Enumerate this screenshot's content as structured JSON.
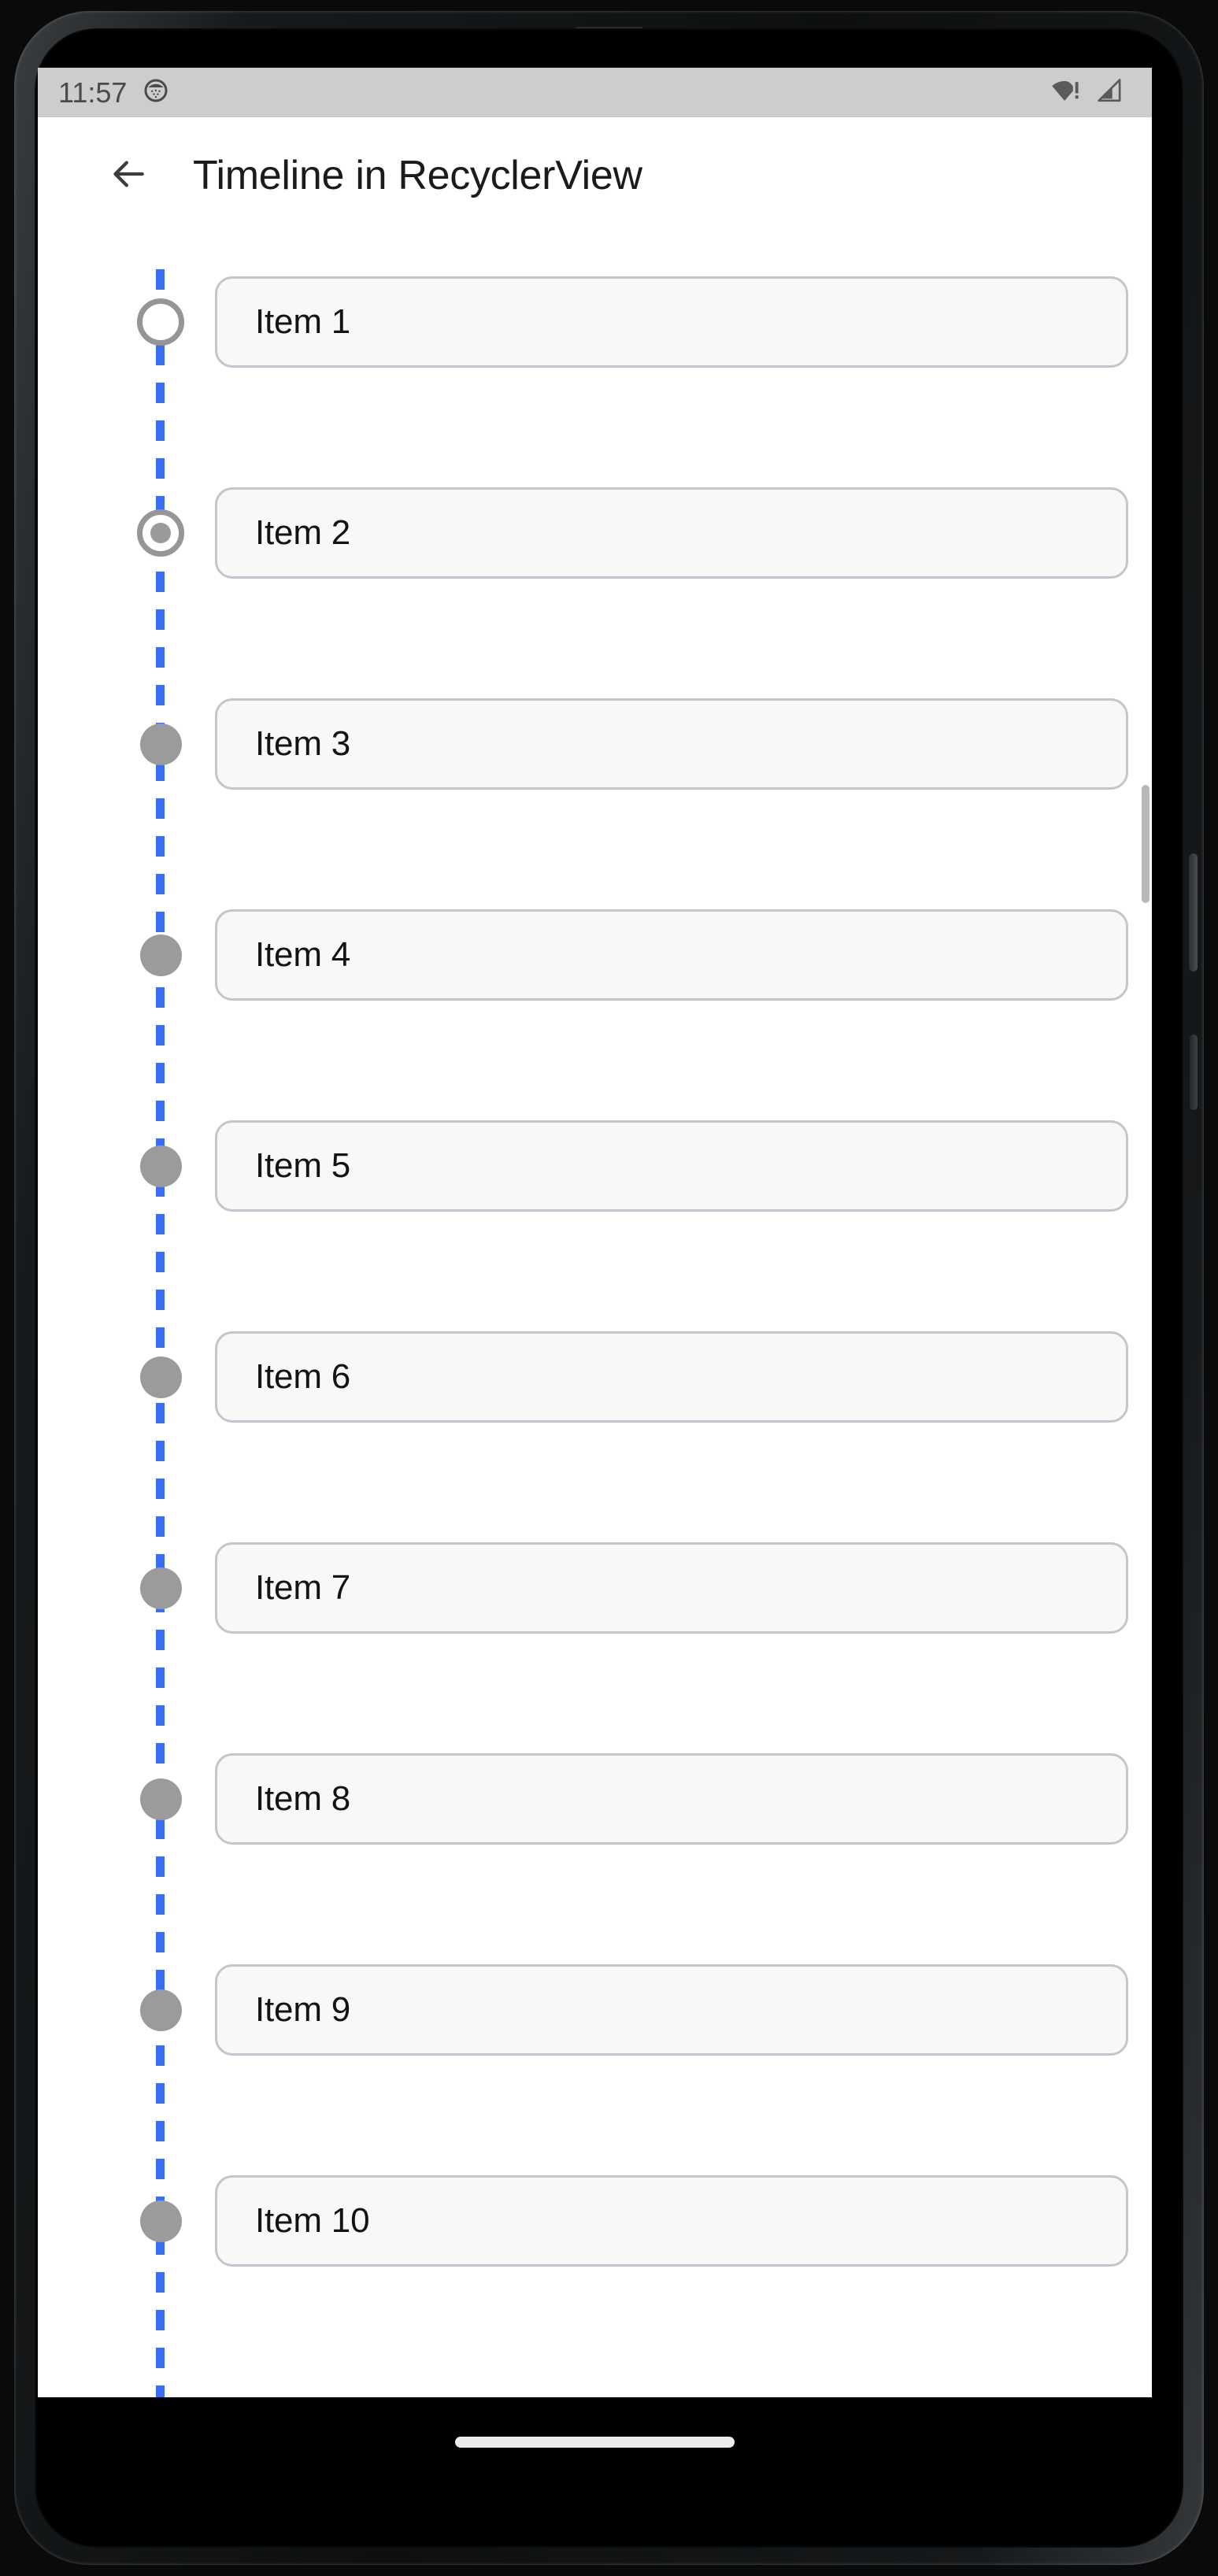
{
  "device": {
    "status_bar": {
      "time": "11:57",
      "notification_icon": "notification-dot-icon",
      "wifi_icon": "wifi-no-internet-icon",
      "signal_icon": "cellular-signal-icon",
      "background_color": "#cdcdcd",
      "icon_color": "#4a4a4a"
    },
    "nav_bar": {
      "gesture_pill": "home-gesture-pill",
      "background_color": "#000000"
    }
  },
  "app_bar": {
    "back_icon": "arrow-left-icon",
    "title": "Timeline in RecyclerView",
    "background_color": "#ffffff",
    "title_color": "#1b1b1f"
  },
  "timeline": {
    "line_color": "#3b6ef5",
    "line_style": "dashed",
    "marker_color": "#9b9b9b",
    "card_background": "#f8f8f9",
    "card_border_color": "#c9c3cd",
    "items": [
      {
        "label": "Item 1",
        "marker": "ring"
      },
      {
        "label": "Item 2",
        "marker": "ring-dot"
      },
      {
        "label": "Item 3",
        "marker": "filled"
      },
      {
        "label": "Item 4",
        "marker": "filled"
      },
      {
        "label": "Item 5",
        "marker": "filled"
      },
      {
        "label": "Item 6",
        "marker": "filled"
      },
      {
        "label": "Item 7",
        "marker": "filled"
      },
      {
        "label": "Item 8",
        "marker": "filled"
      },
      {
        "label": "Item 9",
        "marker": "filled"
      },
      {
        "label": "Item 10",
        "marker": "filled"
      }
    ]
  }
}
